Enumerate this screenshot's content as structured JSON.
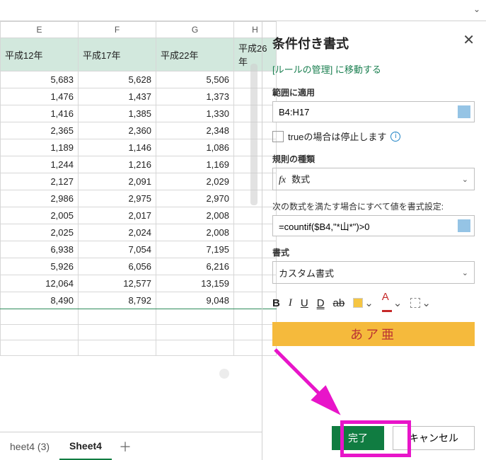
{
  "columns": [
    "E",
    "F",
    "G",
    "H"
  ],
  "header_row": [
    "平成12年",
    "平成17年",
    "平成22年",
    "平成26年"
  ],
  "rows": [
    [
      "5,683",
      "5,628",
      "5,506",
      ""
    ],
    [
      "1,476",
      "1,437",
      "1,373",
      ""
    ],
    [
      "1,416",
      "1,385",
      "1,330",
      ""
    ],
    [
      "2,365",
      "2,360",
      "2,348",
      ""
    ],
    [
      "1,189",
      "1,146",
      "1,086",
      ""
    ],
    [
      "1,244",
      "1,216",
      "1,169",
      ""
    ],
    [
      "2,127",
      "2,091",
      "2,029",
      ""
    ],
    [
      "2,986",
      "2,975",
      "2,970",
      ""
    ],
    [
      "2,005",
      "2,017",
      "2,008",
      ""
    ],
    [
      "2,025",
      "2,024",
      "2,008",
      ""
    ],
    [
      "6,938",
      "7,054",
      "7,195",
      ""
    ],
    [
      "5,926",
      "6,056",
      "6,216",
      ""
    ],
    [
      "12,064",
      "12,577",
      "13,159",
      ""
    ],
    [
      "8,490",
      "8,792",
      "9,048",
      ""
    ]
  ],
  "sheets": {
    "tab1": "heet4 (3)",
    "tab2": "Sheet4"
  },
  "panel": {
    "title": "条件付き書式",
    "link": "[ルールの管理] に移動する",
    "range_label": "範囲に適用",
    "range_value": "B4:H17",
    "stop_label": "trueの場合は停止します",
    "ruletype_label": "規則の種類",
    "ruletype_value": "数式",
    "formula_label": "次の数式を満たす場合にすべて値を書式設定:",
    "formula_value": "=countif($B4,\"*山*\")>0",
    "format_label": "書式",
    "format_value": "カスタム書式",
    "preview": "あア亜",
    "ok": "完了",
    "cancel": "キャンセル"
  }
}
